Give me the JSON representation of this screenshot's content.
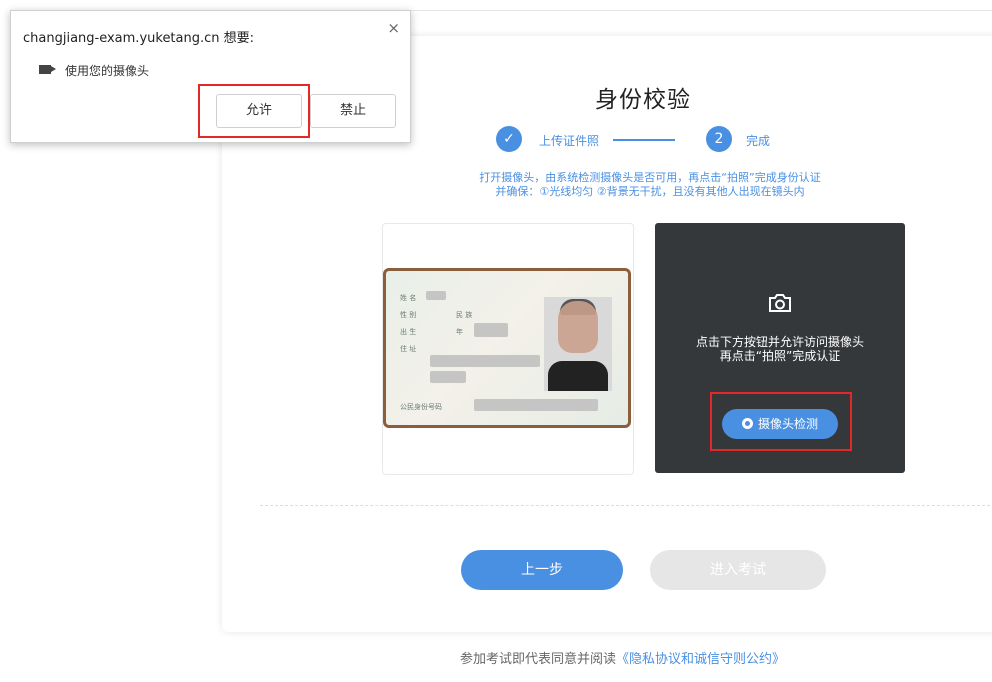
{
  "popup": {
    "origin": "changjiang-exam.yuketang.cn 想要:",
    "permission_text": "使用您的摄像头",
    "allow_label": "允许",
    "block_label": "禁止",
    "close_glyph": "×"
  },
  "page": {
    "title": "身份校验",
    "steps": [
      {
        "label": "上传证件照",
        "state": "done",
        "glyph": "✓"
      },
      {
        "number": "2",
        "label": "完成",
        "state": "active"
      }
    ],
    "hint_line1": "打开摄像头，由系统检测摄像头是否可用，再点击“拍照”完成身份认证",
    "hint_line2": "并确保：①光线均匀 ②背景无干扰，且没有其他人出现在镜头内",
    "id_card": {
      "label_name": "姓 名",
      "label_sex": "性 别",
      "label_ethnic": "民 族",
      "label_birth": "出 生",
      "label_year": "年",
      "label_address": "住 址",
      "label_idnum": "公民身份号码"
    },
    "camera_panel": {
      "icon": "camera-icon",
      "line1": "点击下方按钮并允许访问摄像头",
      "line2": "再点击“拍照”完成认证",
      "detect_label": "摄像头检测"
    },
    "prev_label": "上一步",
    "next_label": "进入考试",
    "footer_text": "参加考试即代表同意并阅读",
    "footer_link": "《隐私协议和诚信守则公约》"
  },
  "colors": {
    "accent": "#4a90e2",
    "highlight": "#e52727",
    "camera_panel_bg": "#35383b",
    "disabled_btn": "#e6e6e6"
  }
}
